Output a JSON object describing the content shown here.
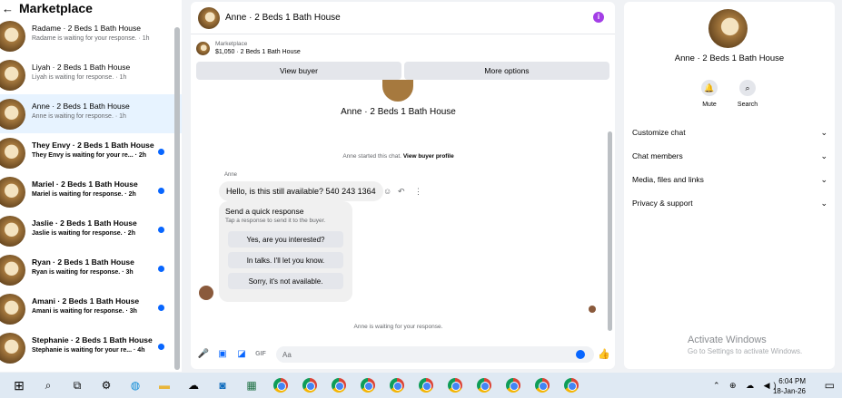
{
  "left_panel": {
    "title": "Marketplace",
    "conversations": [
      {
        "name": "Radame · 2 Beds 1 Bath House",
        "preview": "Radame is waiting for your response. · 1h",
        "unread": false,
        "active": false
      },
      {
        "name": "Liyah · 2 Beds 1 Bath House",
        "preview": "Liyah is waiting for response. · 1h",
        "unread": false,
        "active": false
      },
      {
        "name": "Anne · 2 Beds 1 Bath House",
        "preview": "Anne is waiting for response. · 1h",
        "unread": false,
        "active": true
      },
      {
        "name": "They Envy · 2 Beds 1 Bath House",
        "preview": "They Envy is waiting for your re... · 2h",
        "unread": true,
        "active": false
      },
      {
        "name": "Mariel · 2 Beds 1 Bath House",
        "preview": "Mariel is waiting for response. · 2h",
        "unread": true,
        "active": false
      },
      {
        "name": "Jaslie · 2 Beds 1 Bath House",
        "preview": "Jaslie is waiting for response. · 2h",
        "unread": true,
        "active": false
      },
      {
        "name": "Ryan · 2 Beds 1 Bath House",
        "preview": "Ryan is waiting for response. · 3h",
        "unread": true,
        "active": false
      },
      {
        "name": "Amani · 2 Beds 1 Bath House",
        "preview": "Amani is waiting for response. · 3h",
        "unread": true,
        "active": false
      },
      {
        "name": "Stephanie · 2 Beds 1 Bath House",
        "preview": "Stephanie is waiting for your re... · 4h",
        "unread": true,
        "active": false
      }
    ]
  },
  "chat": {
    "header_title": "Anne · 2 Beds 1 Bath House",
    "marketplace_label": "Marketplace",
    "listing": "$1,050 · 2 Beds 1 Bath House",
    "view_buyer": "View buyer",
    "more_options": "More options",
    "chat_title": "Anne · 2 Beds 1 Bath House",
    "system_message": "Anne started this chat.",
    "system_link": "View buyer profile",
    "sender": "Anne",
    "message": "Hello, is this still available? 540 243 1364",
    "quick_title": "Send a quick response",
    "quick_subtitle": "Tap a response to send it to the buyer.",
    "quick_responses": [
      "Yes, are you interested?",
      "In talks. I'll let you know.",
      "Sorry, it's not available."
    ],
    "waiting": "Anne is waiting for your response.",
    "composer_placeholder": "Aa"
  },
  "details": {
    "name": "Anne · 2 Beds 1 Bath House",
    "mute": "Mute",
    "search": "Search",
    "sections": [
      "Customize chat",
      "Chat members",
      "Media, files and links",
      "Privacy & support"
    ]
  },
  "watermark": {
    "title": "Activate Windows",
    "subtitle": "Go to Settings to activate Windows."
  },
  "taskbar": {
    "time": "6:04 PM",
    "date": "18-Jan-26"
  },
  "colors": {
    "accent": "#0866ff",
    "info": "#a33ee6"
  }
}
